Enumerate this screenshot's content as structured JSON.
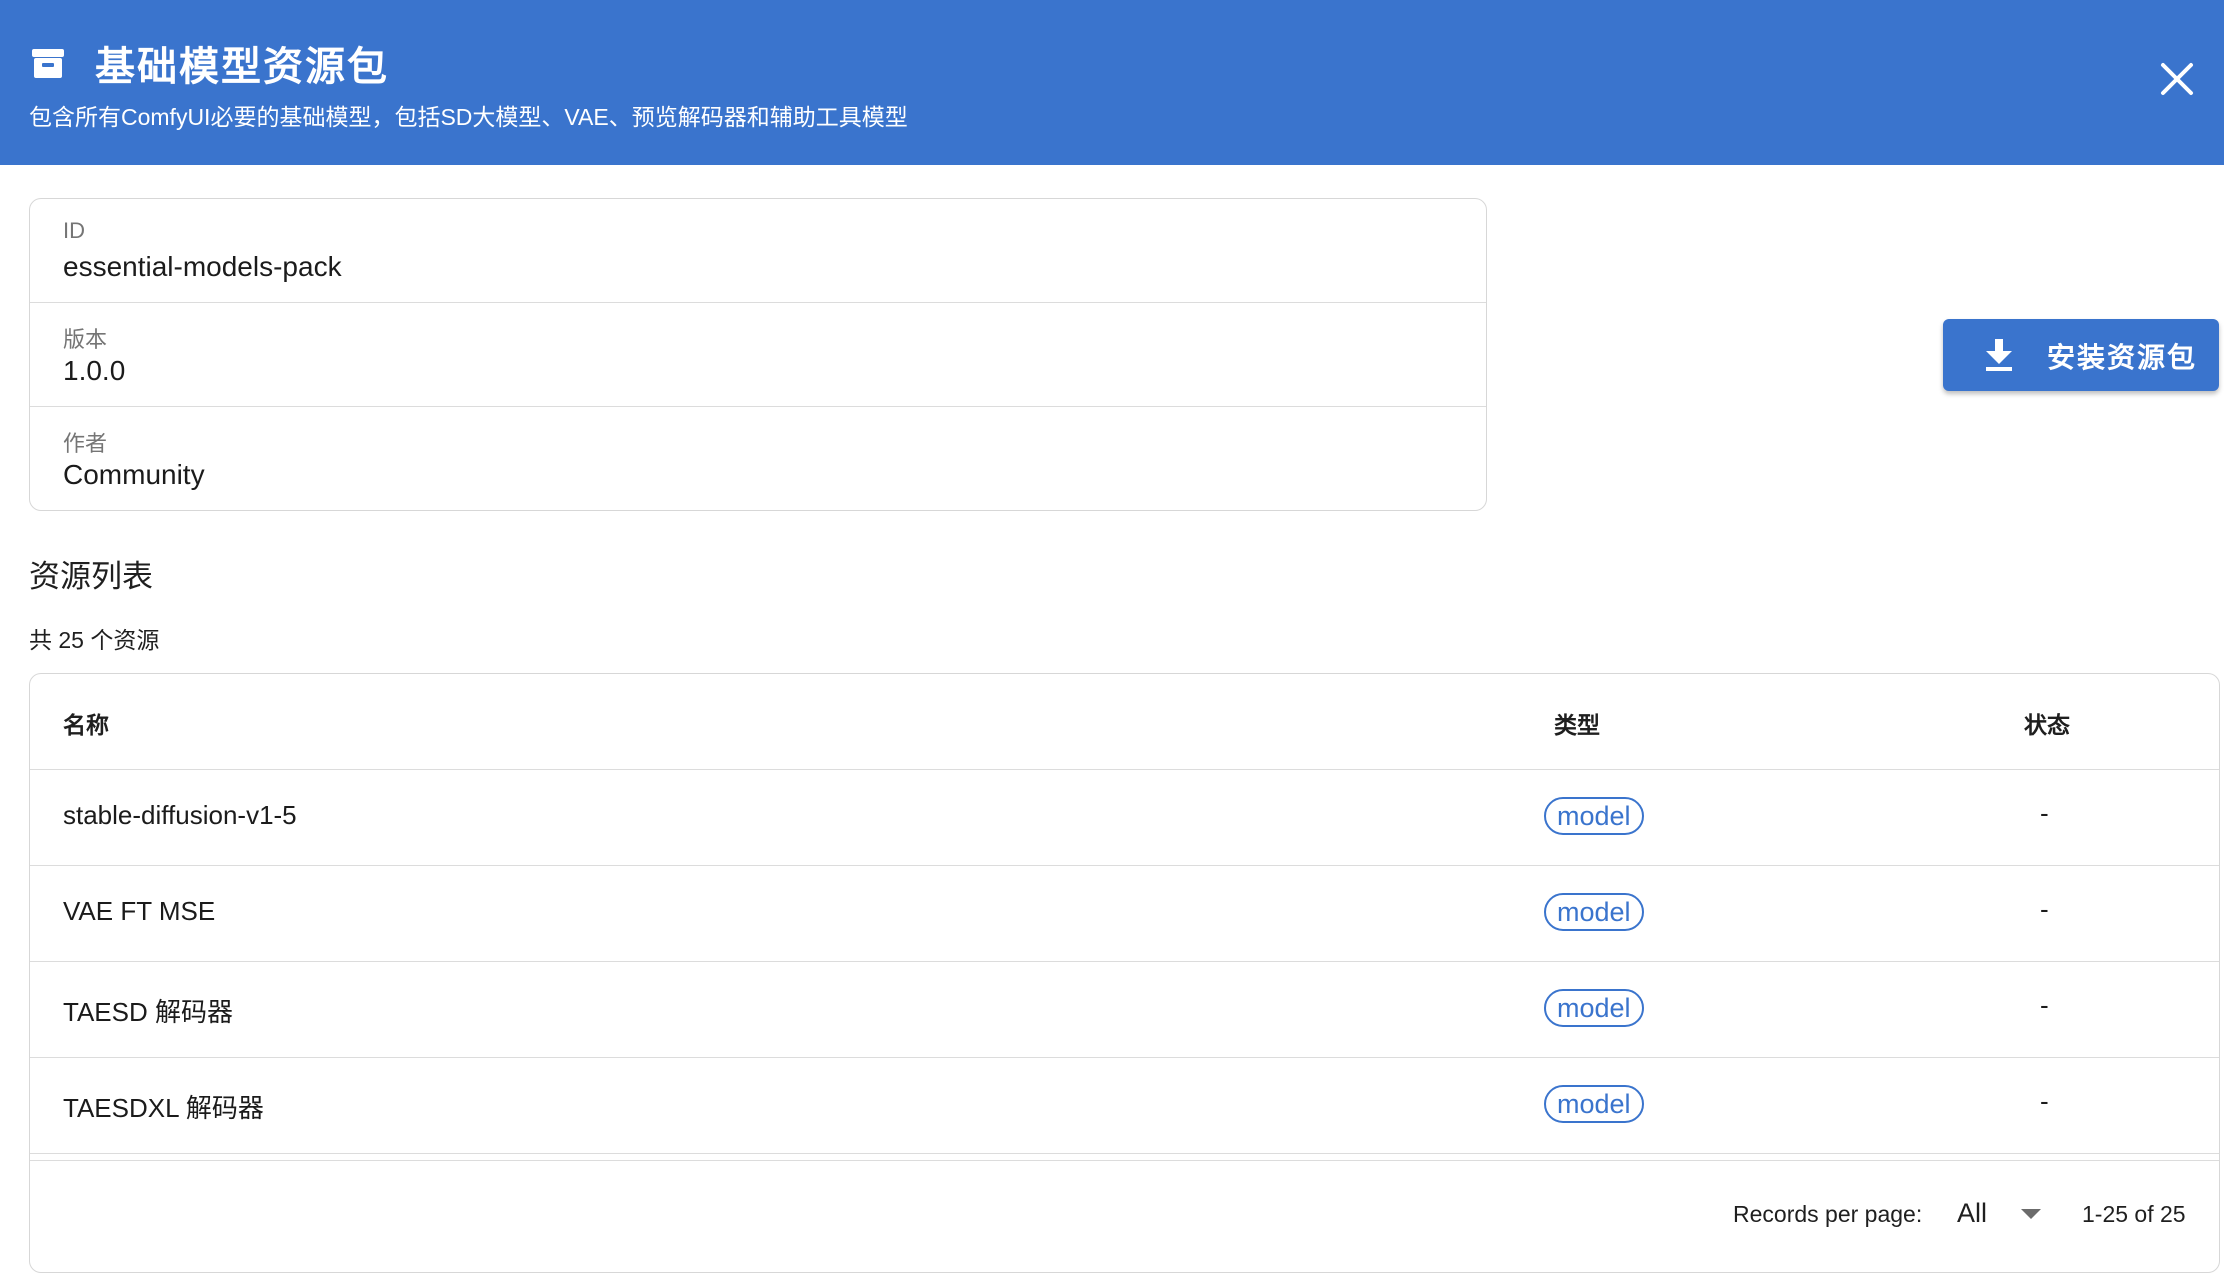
{
  "header": {
    "title": "基础模型资源包",
    "subtitle": "包含所有ComfyUI必要的基础模型，包括SD大模型、VAE、预览解码器和辅助工具模型",
    "icon": "archive-box-icon",
    "close_icon": "close-icon",
    "background_color": "#3a74cd"
  },
  "info": {
    "id_label": "ID",
    "id_value": "essential-models-pack",
    "version_label": "版本",
    "version_value": "1.0.0",
    "author_label": "作者",
    "author_value": "Community"
  },
  "install_button": {
    "label": "安装资源包",
    "icon": "download-icon"
  },
  "resources": {
    "section_title": "资源列表",
    "count_text": "共 25 个资源",
    "columns": {
      "name": "名称",
      "type": "类型",
      "status": "状态"
    },
    "rows": [
      {
        "name": "stable-diffusion-v1-5",
        "type": "model",
        "status": "-"
      },
      {
        "name": "VAE FT MSE",
        "type": "model",
        "status": "-"
      },
      {
        "name": "TAESD 解码器",
        "type": "model",
        "status": "-"
      },
      {
        "name": "TAESDXL 解码器",
        "type": "model",
        "status": "-"
      }
    ]
  },
  "pagination": {
    "records_per_page_label": "Records per page:",
    "records_per_page_value": "All",
    "range_text": "1-25 of 25"
  },
  "colors": {
    "accent": "#3a74cd",
    "border": "#d7d7d7"
  }
}
